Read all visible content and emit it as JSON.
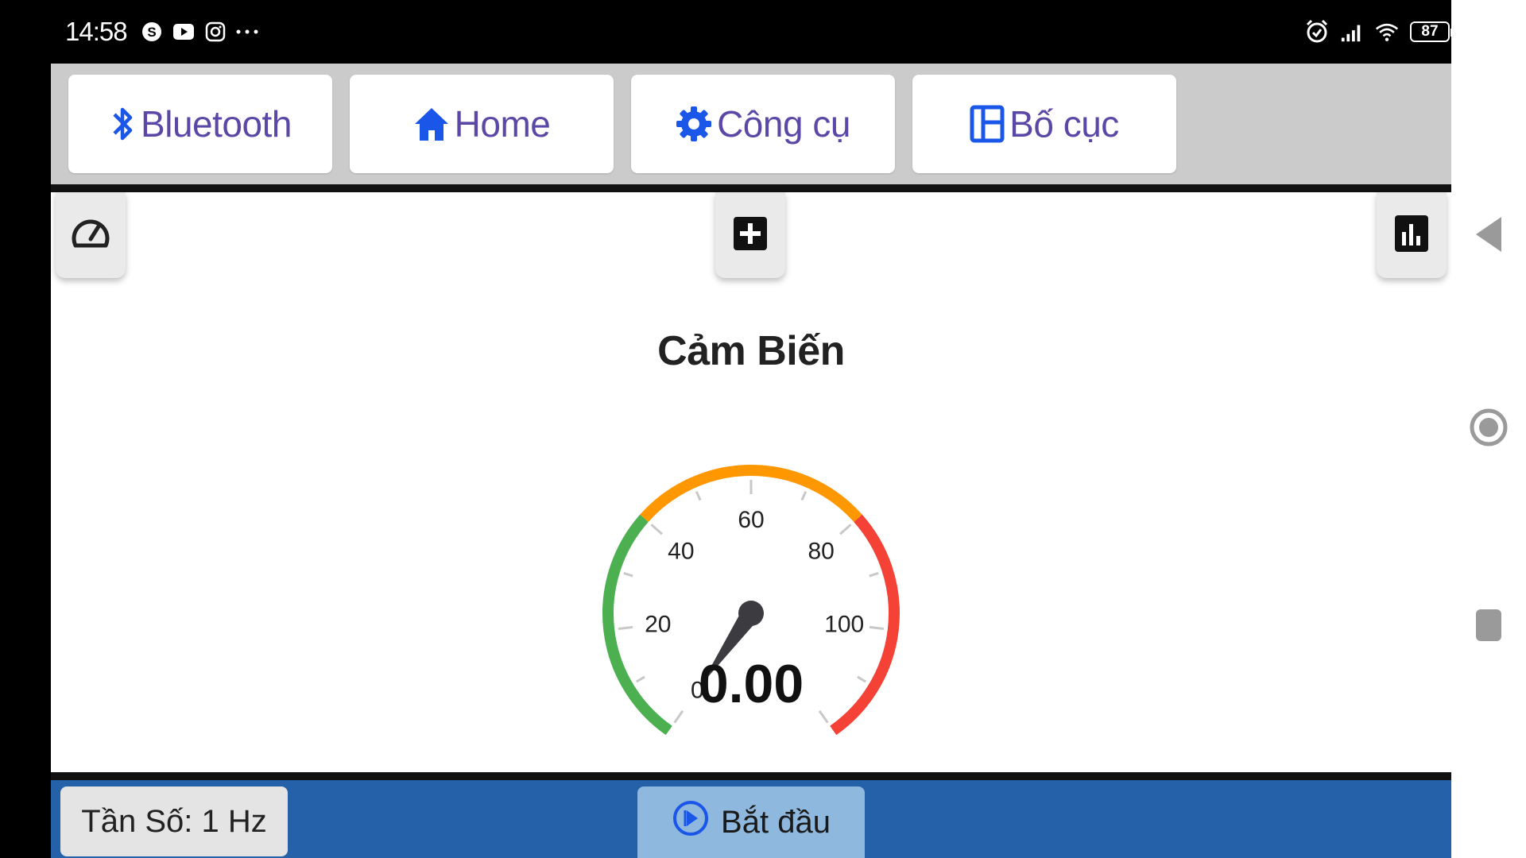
{
  "status_bar": {
    "time": "14:58",
    "battery": "87",
    "left_icons": [
      "skype-icon",
      "youtube-icon",
      "instagram-icon",
      "more-dots-icon"
    ],
    "right_icons": [
      "alarm-icon",
      "signal-icon",
      "wifi-icon",
      "battery-icon"
    ]
  },
  "tabs": [
    {
      "label": "Bluetooth",
      "icon": "bluetooth-icon"
    },
    {
      "label": "Home",
      "icon": "home-icon"
    },
    {
      "label": "Công cụ",
      "icon": "gear-icon"
    },
    {
      "label": "Bố cục",
      "icon": "layout-icon"
    }
  ],
  "toolbar": {
    "left_icon": "speedometer-icon",
    "center_icon": "add-box-icon",
    "right_icon": "bar-chart-icon"
  },
  "gauge": {
    "title": "Cảm Biến",
    "value": 0.0,
    "value_text": "0.00",
    "min": 0,
    "max": 120,
    "tick_labels": [
      "0",
      "20",
      "40",
      "60",
      "80",
      "100"
    ],
    "zones": [
      {
        "from": 0,
        "to": 40,
        "color": "#4caf50"
      },
      {
        "from": 40,
        "to": 80,
        "color": "#ff9800"
      },
      {
        "from": 80,
        "to": 120,
        "color": "#f44336"
      }
    ]
  },
  "bottom": {
    "frequency_label": "Tần Số: 1 Hz",
    "start_label": "Bắt đầu"
  },
  "colors": {
    "tab_text": "#5b47a6",
    "tab_icon": "#1a56e8",
    "bottom_bar": "#2561a8",
    "start_button": "#8fb8de"
  }
}
